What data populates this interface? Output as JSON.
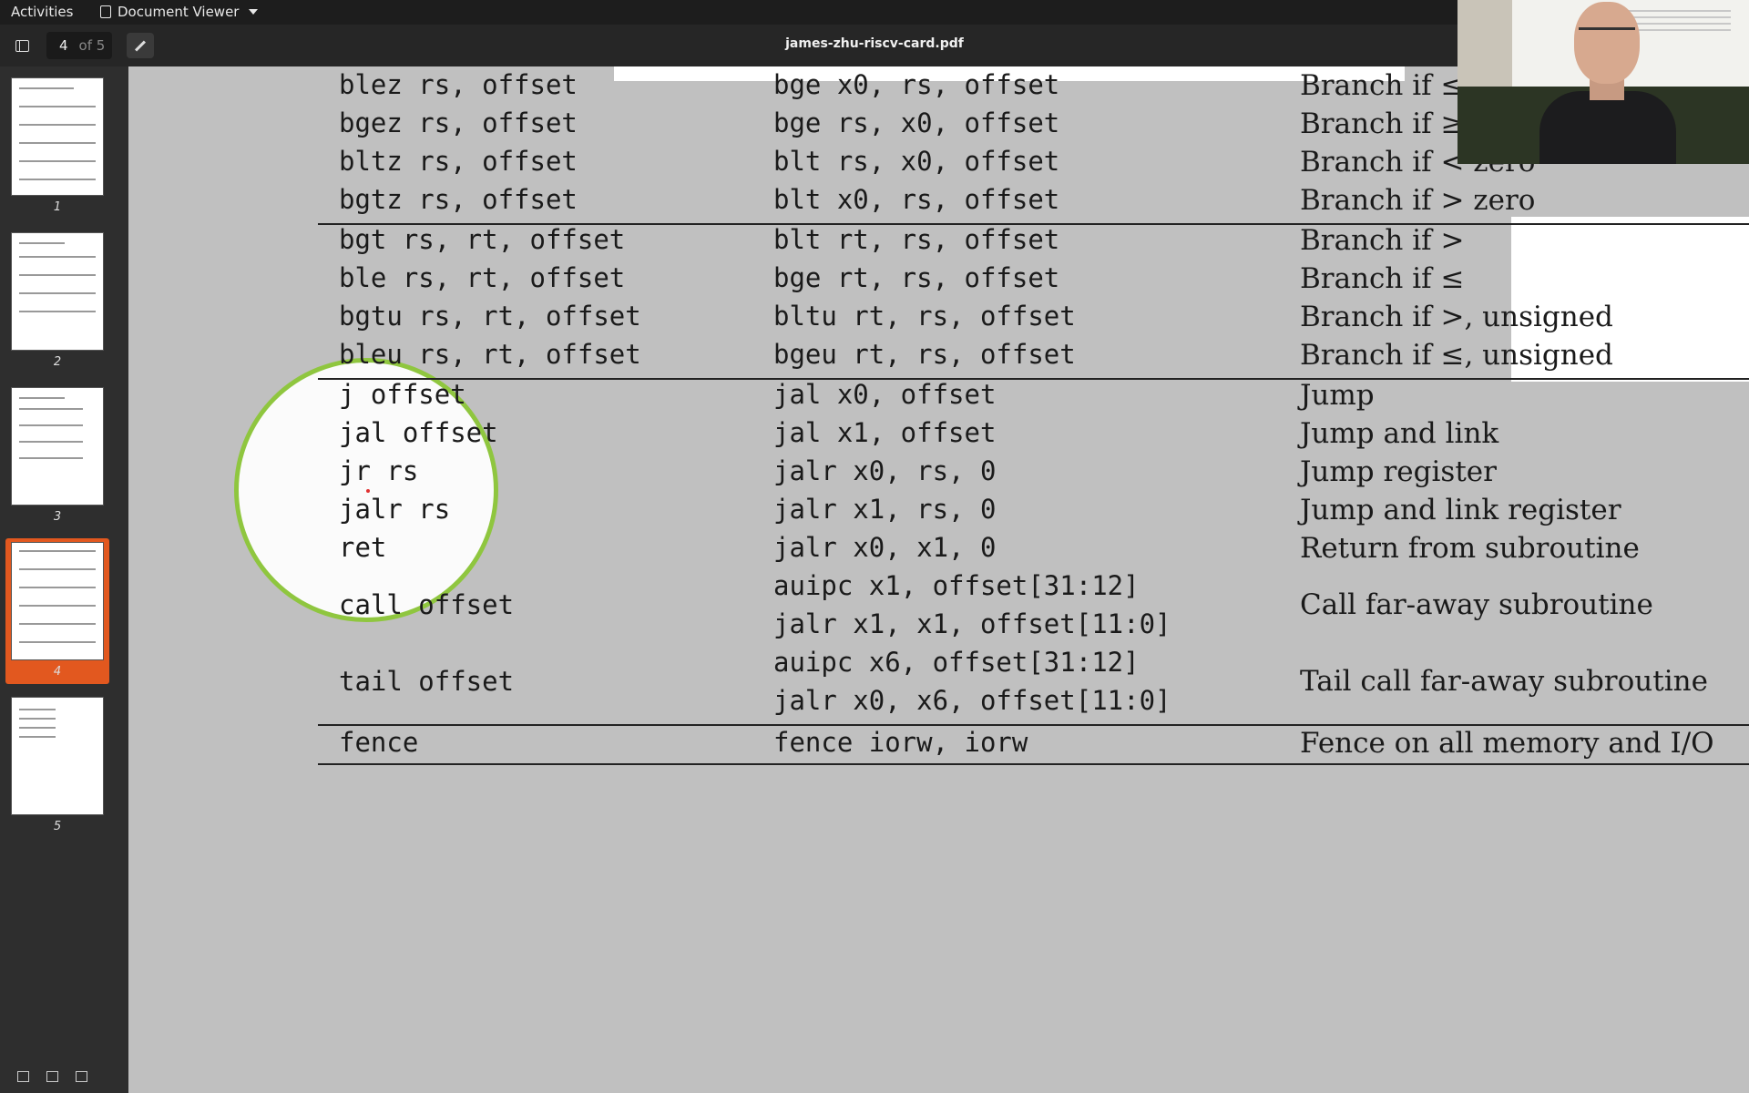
{
  "topbar": {
    "activities": "Activities",
    "app_name": "Document Viewer"
  },
  "header": {
    "current_page": "4",
    "page_total": "of 5",
    "title": "james-zhu-riscv-card.pdf"
  },
  "sidebar": {
    "thumbnails": [
      {
        "label": "1"
      },
      {
        "label": "2"
      },
      {
        "label": "3"
      },
      {
        "label": "4",
        "selected": true
      },
      {
        "label": "5"
      }
    ],
    "tools": [
      "grid-icon",
      "edit-icon",
      "bookmark-icon"
    ]
  },
  "doc": {
    "rows": [
      {
        "pseudo": "blez rs, offset",
        "base": "bge x0, rs, offset",
        "meaning": "Branch if ≤"
      },
      {
        "pseudo": "bgez rs, offset",
        "base": "bge rs, x0, offset",
        "meaning": "Branch if ≥"
      },
      {
        "pseudo": "bltz rs, offset",
        "base": "blt rs, x0, offset",
        "meaning": "Branch if < zero"
      },
      {
        "pseudo": "bgtz rs, offset",
        "base": "blt x0, rs, offset",
        "meaning": "Branch if > zero"
      },
      {
        "pseudo": "bgt rs, rt, offset",
        "base": "blt rt, rs, offset",
        "meaning": "Branch if >"
      },
      {
        "pseudo": "ble rs, rt, offset",
        "base": "bge rt, rs, offset",
        "meaning": "Branch if ≤"
      },
      {
        "pseudo": "bgtu rs, rt, offset",
        "base": "bltu rt, rs, offset",
        "meaning": "Branch if >, unsigned"
      },
      {
        "pseudo": "bleu rs, rt, offset",
        "base": "bgeu rt, rs, offset",
        "meaning": "Branch if ≤, unsigned"
      },
      {
        "pseudo": "j offset",
        "base": "jal x0, offset",
        "meaning": "Jump"
      },
      {
        "pseudo": "jal offset",
        "base": "jal x1, offset",
        "meaning": "Jump and link"
      },
      {
        "pseudo": "jr rs",
        "base": "jalr x0, rs, 0",
        "meaning": "Jump register"
      },
      {
        "pseudo": "jalr rs",
        "base": "jalr x1, rs, 0",
        "meaning": "Jump and link register"
      },
      {
        "pseudo": "ret",
        "base": "jalr x0, x1, 0",
        "meaning": "Return from subroutine"
      }
    ],
    "call": {
      "pseudo": "call offset",
      "base1": "auipc x1, offset[31:12]",
      "base2": "jalr x1, x1, offset[11:0]",
      "meaning": "Call far-away subroutine"
    },
    "tail": {
      "pseudo": "tail offset",
      "base1": "auipc x6, offset[31:12]",
      "base2": "jalr x0, x6, offset[11:0]",
      "meaning": "Tail call far-away subroutine"
    },
    "fence": {
      "pseudo": "fence",
      "base": "fence iorw, iorw",
      "meaning": "Fence on all memory and I/O"
    }
  },
  "colors": {
    "selection": "#e2581f",
    "magnifier_ring": "#8fc63f",
    "page_bg": "#c0c0c0"
  }
}
